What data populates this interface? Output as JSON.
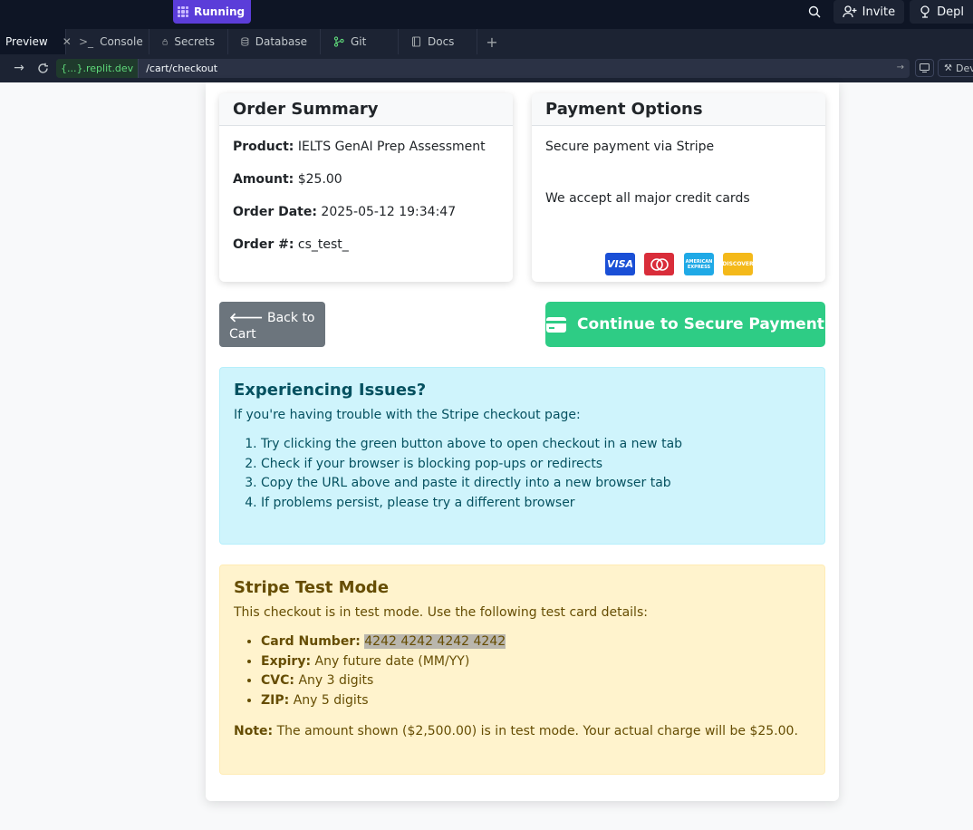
{
  "topbar": {
    "status_label": "Running",
    "invite_label": "Invite",
    "deploy_label": "Depl"
  },
  "tabs": [
    {
      "label": "Preview",
      "icon": "preview-icon"
    },
    {
      "label": "Console",
      "icon": "console-icon"
    },
    {
      "label": "Secrets",
      "icon": "lock-icon"
    },
    {
      "label": "Database",
      "icon": "database-icon"
    },
    {
      "label": "Git",
      "icon": "git-icon"
    },
    {
      "label": "Docs",
      "icon": "book-icon"
    }
  ],
  "urlbar": {
    "host": "{...}.replit.dev",
    "path": "/cart/checkout",
    "devtools_label": "Dev"
  },
  "order_summary": {
    "title": "Order Summary",
    "product_label": "Product:",
    "product": "IELTS GenAI Prep Assessment",
    "amount_label": "Amount:",
    "amount": "$25.00",
    "date_label": "Order Date:",
    "date": "2025-05-12 19:34:47",
    "order_no_label": "Order #:",
    "order_no": "cs_test_"
  },
  "payment_options": {
    "title": "Payment Options",
    "secure_text": "Secure payment via Stripe",
    "accept_text": "We accept all major credit cards",
    "cards": [
      "VISA",
      "mastercard",
      "AMERICAN EXPRESS",
      "DISCOVER"
    ]
  },
  "buttons": {
    "back": "Back to Cart",
    "continue": "Continue to Secure Payment"
  },
  "issues": {
    "title": "Experiencing Issues?",
    "intro": "If you're having trouble with the Stripe checkout page:",
    "steps": [
      "Try clicking the green button above to open checkout in a new tab",
      "Check if your browser is blocking pop-ups or redirects",
      "Copy the URL above and paste it directly into a new browser tab",
      "If problems persist, please try a different browser"
    ]
  },
  "test_mode": {
    "title": "Stripe Test Mode",
    "intro": "This checkout is in test mode. Use the following test card details:",
    "card_label": "Card Number:",
    "card_value": "4242 4242 4242 4242",
    "expiry_label": "Expiry:",
    "expiry_value": "Any future date (MM/YY)",
    "cvc_label": "CVC:",
    "cvc_value": "Any 3 digits",
    "zip_label": "ZIP:",
    "zip_value": "Any 5 digits",
    "note_label": "Note:",
    "note_text": "The amount shown ($2,500.00) is in test mode. Your actual charge will be $25.00."
  },
  "colors": {
    "accent_green": "#2ecc85",
    "replit_purple": "#5b3dd9",
    "info_bg": "#cff4fc",
    "warn_bg": "#fff3cd"
  }
}
